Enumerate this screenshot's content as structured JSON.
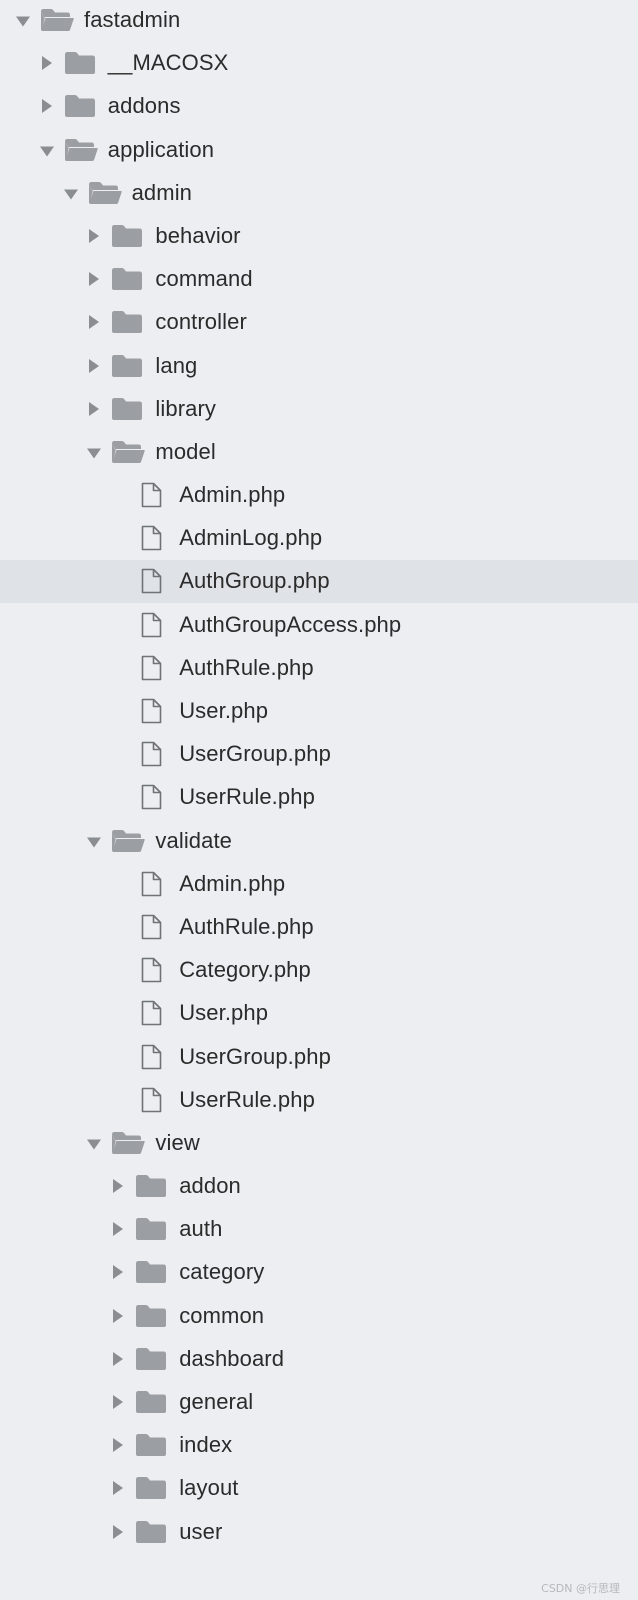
{
  "explorer": {
    "items": [
      {
        "label": "fastadmin",
        "kind": "folder",
        "state": "expanded",
        "depth": 0
      },
      {
        "label": "__MACOSX",
        "kind": "folder",
        "state": "collapsed",
        "depth": 1
      },
      {
        "label": "addons",
        "kind": "folder",
        "state": "collapsed",
        "depth": 1
      },
      {
        "label": "application",
        "kind": "folder",
        "state": "expanded",
        "depth": 1
      },
      {
        "label": "admin",
        "kind": "folder",
        "state": "expanded",
        "depth": 2
      },
      {
        "label": "behavior",
        "kind": "folder",
        "state": "collapsed",
        "depth": 3
      },
      {
        "label": "command",
        "kind": "folder",
        "state": "collapsed",
        "depth": 3
      },
      {
        "label": "controller",
        "kind": "folder",
        "state": "collapsed",
        "depth": 3
      },
      {
        "label": "lang",
        "kind": "folder",
        "state": "collapsed",
        "depth": 3
      },
      {
        "label": "library",
        "kind": "folder",
        "state": "collapsed",
        "depth": 3
      },
      {
        "label": "model",
        "kind": "folder",
        "state": "expanded",
        "depth": 3
      },
      {
        "label": "Admin.php",
        "kind": "file",
        "depth": 4
      },
      {
        "label": "AdminLog.php",
        "kind": "file",
        "depth": 4
      },
      {
        "label": "AuthGroup.php",
        "kind": "file",
        "depth": 4,
        "selected": true
      },
      {
        "label": "AuthGroupAccess.php",
        "kind": "file",
        "depth": 4
      },
      {
        "label": "AuthRule.php",
        "kind": "file",
        "depth": 4
      },
      {
        "label": "User.php",
        "kind": "file",
        "depth": 4
      },
      {
        "label": "UserGroup.php",
        "kind": "file",
        "depth": 4
      },
      {
        "label": "UserRule.php",
        "kind": "file",
        "depth": 4
      },
      {
        "label": "validate",
        "kind": "folder",
        "state": "expanded",
        "depth": 3
      },
      {
        "label": "Admin.php",
        "kind": "file",
        "depth": 4
      },
      {
        "label": "AuthRule.php",
        "kind": "file",
        "depth": 4
      },
      {
        "label": "Category.php",
        "kind": "file",
        "depth": 4
      },
      {
        "label": "User.php",
        "kind": "file",
        "depth": 4
      },
      {
        "label": "UserGroup.php",
        "kind": "file",
        "depth": 4
      },
      {
        "label": "UserRule.php",
        "kind": "file",
        "depth": 4
      },
      {
        "label": "view",
        "kind": "folder",
        "state": "expanded",
        "depth": 3
      },
      {
        "label": "addon",
        "kind": "folder",
        "state": "collapsed",
        "depth": 4
      },
      {
        "label": "auth",
        "kind": "folder",
        "state": "collapsed",
        "depth": 4
      },
      {
        "label": "category",
        "kind": "folder",
        "state": "collapsed",
        "depth": 4
      },
      {
        "label": "common",
        "kind": "folder",
        "state": "collapsed",
        "depth": 4
      },
      {
        "label": "dashboard",
        "kind": "folder",
        "state": "collapsed",
        "depth": 4
      },
      {
        "label": "general",
        "kind": "folder",
        "state": "collapsed",
        "depth": 4
      },
      {
        "label": "index",
        "kind": "folder",
        "state": "collapsed",
        "depth": 4
      },
      {
        "label": "layout",
        "kind": "folder",
        "state": "collapsed",
        "depth": 4
      },
      {
        "label": "user",
        "kind": "folder",
        "state": "collapsed",
        "depth": 4
      }
    ]
  },
  "watermark": "CSDN @行思理",
  "colors": {
    "background": "#eceef1",
    "selected_row": "#dfe2e6",
    "folder_icon": "#9b9ea3",
    "file_icon_stroke": "#6f7277",
    "twisty": "#8a8d92",
    "text": "#2b2b2b"
  },
  "icons": {
    "folder_collapsed": "folder-icon",
    "folder_expanded": "folder-open-icon",
    "file": "file-icon",
    "twisty_collapsed": "chevron-right-icon",
    "twisty_expanded": "chevron-down-icon"
  }
}
